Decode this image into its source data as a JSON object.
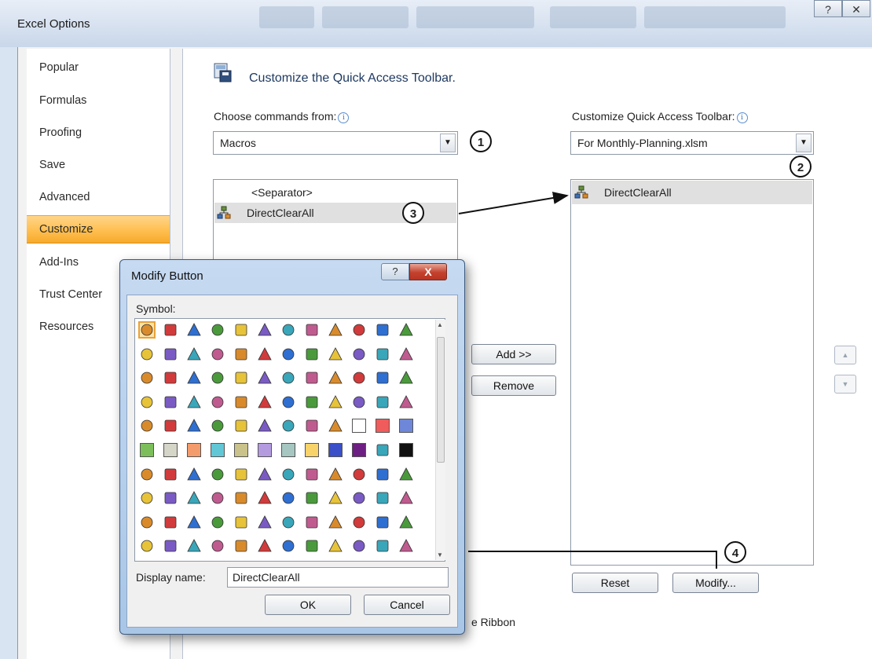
{
  "window": {
    "title": "Excel Options",
    "help_glyph": "?",
    "close_glyph": "✕"
  },
  "nav": {
    "items": [
      {
        "label": "Popular"
      },
      {
        "label": "Formulas"
      },
      {
        "label": "Proofing"
      },
      {
        "label": "Save"
      },
      {
        "label": "Advanced"
      },
      {
        "label": "Customize",
        "selected": true
      },
      {
        "label": "Add-Ins"
      },
      {
        "label": "Trust Center"
      },
      {
        "label": "Resources"
      }
    ]
  },
  "main": {
    "heading": "Customize the Quick Access Toolbar.",
    "choose_label": "Choose commands from:",
    "choose_value": "Macros",
    "qat_label": "Customize Quick Access Toolbar:",
    "qat_value": "For Monthly-Planning.xlsm",
    "commands": [
      {
        "label": "<Separator>"
      },
      {
        "label": "DirectClearAll",
        "selected": true
      }
    ],
    "toolbar_items": [
      {
        "label": "DirectClearAll",
        "selected": true
      }
    ],
    "add_button": "Add >>",
    "remove_button": "Remove",
    "reset_button": "Reset",
    "modify_button": "Modify...",
    "ribbon_tail": "e Ribbon",
    "callouts": [
      "1",
      "2",
      "3",
      "4"
    ]
  },
  "dialog": {
    "title": "Modify Button",
    "help_glyph": "?",
    "close_glyph": "X",
    "symbol_label": "Symbol:",
    "display_name_label": "Display name:",
    "display_name_value": "DirectClearAll",
    "ok_button": "OK",
    "cancel_button": "Cancel",
    "icons": [
      "macro",
      "error",
      "info",
      "target",
      "warning",
      "exclamation",
      "diamond-warning",
      "shield",
      "save",
      "copy",
      "paste",
      "folder",
      "blank-page",
      "open-folder",
      "folders",
      "edit-folder",
      "printer",
      "picture",
      "edit-page",
      "home",
      "smiley-ball",
      "back-arrows",
      "forward-arrows",
      "left-arrow",
      "up-arrow",
      "down-arrow",
      "right-arrow",
      "back-circle",
      "pen",
      "lock",
      "key",
      "ruler",
      "marker",
      "window",
      "magnifier",
      "filter",
      "filter",
      "book",
      "scales",
      "rings",
      "paint",
      "tools",
      "user",
      "people",
      "clock",
      "snowflake",
      "hand",
      "smiley",
      "sad",
      "calculator",
      "phone",
      "piggy",
      "eight-ball",
      "dollar",
      "eye",
      "ufo",
      "colors",
      "white-square",
      "red-square",
      "blue-square",
      "green-square",
      "gray-square",
      "orange-square",
      "cyan-square",
      "olive-square",
      "lilac-square",
      "teal-square",
      "yellow-square",
      "indigo-square",
      "purple-square",
      "contrast-square",
      "black-square",
      "bar-square",
      "outline-square",
      "dotted-square",
      "half-square",
      "empty-square",
      "top-bar-square",
      "checker-square",
      "arrow-circle",
      "bar-chart",
      "drop",
      "mountain",
      "stack",
      "pie",
      "donut",
      "cylinder",
      "layers",
      "box",
      "flag",
      "landscape",
      "frame",
      "portrait",
      "flower",
      "photo",
      "star",
      "text-a",
      "text-a-dark",
      "cross",
      "check",
      "draw",
      "refresh",
      "matrix",
      "pi",
      "bucket",
      "binoculars",
      "brush",
      "list",
      "play",
      "anchor",
      "gears",
      "lasso",
      "copy-stack",
      "building",
      "folder-tab",
      "eraser",
      "chart-letter",
      "bird",
      "bell",
      "table"
    ]
  },
  "colors": {
    "nav_selected": "#ffbf4f",
    "accent_blue": "#1f3a62",
    "close_red": "#c3422e"
  }
}
